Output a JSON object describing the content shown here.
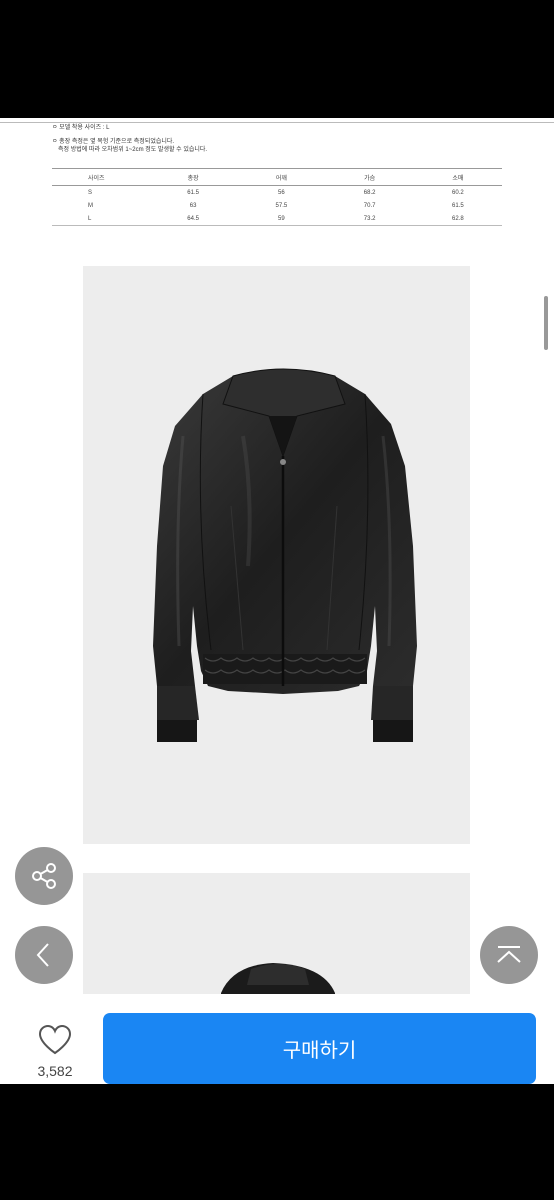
{
  "notes": {
    "model_size": "ㅇ 모델 착용 사이즈 : L",
    "measure_line1": "ㅇ 총장 측정은 옆 목헝 기준으로 측정되었습니다.",
    "measure_line2": "측정 방법에 따라 오차범위 1~2cm 정도 발생할 수 있습니다."
  },
  "size_table": {
    "headers": [
      "사이즈",
      "총장",
      "어깨",
      "가슴",
      "소매"
    ],
    "rows": [
      [
        "S",
        "61.5",
        "56",
        "68.2",
        "60.2"
      ],
      [
        "M",
        "63",
        "57.5",
        "70.7",
        "61.5"
      ],
      [
        "L",
        "64.5",
        "59",
        "73.2",
        "62.8"
      ]
    ]
  },
  "icons": {
    "share": "share-icon",
    "back": "chevron-left-icon",
    "top": "scroll-top-icon",
    "like": "heart-icon"
  },
  "bottom_bar": {
    "like_count": "3,582",
    "buy_label": "구매하기"
  },
  "colors": {
    "accent": "#1a86f3",
    "jacket": "#222222"
  }
}
